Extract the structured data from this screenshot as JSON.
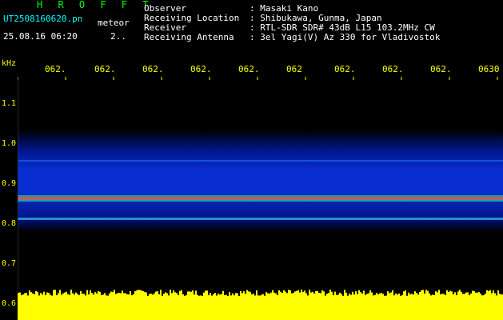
{
  "header": {
    "brand": "H R O F F T",
    "filename": "UT2508160620.pn",
    "mode": "meteor",
    "datetime": "25.08.16 06:20",
    "datetime_extra": "2..",
    "meta": [
      {
        "key": "Observer",
        "value": ": Masaki Kano"
      },
      {
        "key": "Receiving Location",
        "value": ": Shibukawa, Gunma, Japan"
      },
      {
        "key": "Receiver",
        "value": ": RTL-SDR SDR# 43dB L15 103.2MHz CW"
      },
      {
        "key": "Receiving Antenna",
        "value": ": 3el Yagi(V) Az 330 for Vladivostok"
      }
    ]
  },
  "spectrogram": {
    "y_unit": "kHz",
    "x_ticks": [
      "062.",
      "062.",
      "062.",
      "062.",
      "062.",
      "062",
      "062.",
      "062.",
      "062.",
      "0630"
    ],
    "y_ticks": [
      "1.1",
      "1.0",
      "0.9",
      "0.8",
      "0.7",
      "0.6"
    ],
    "colors": {
      "background": "#000000",
      "axis": "#ffff00",
      "text": "#ffffff",
      "brand": "#00ff00"
    }
  }
}
